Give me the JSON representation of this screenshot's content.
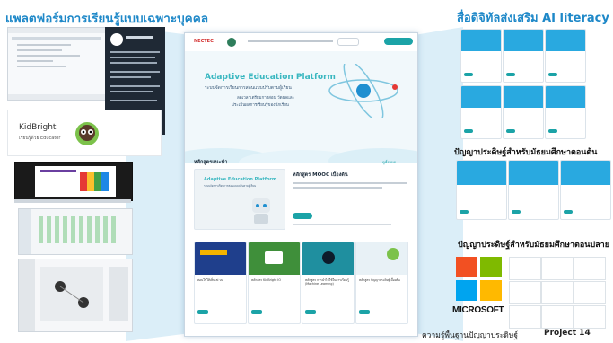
{
  "left_title": "แพลตฟอร์มการเรียนรู้แบบเฉพาะบุคคล",
  "right_title": "สื่อดิจิทัลส่งเสริม AI literacy",
  "kidbright": {
    "name": "KidBright",
    "sub": "เรียนรู้ด้วย Educator"
  },
  "site": {
    "brand": "NECTEC",
    "hero_title": "Adaptive Education Platform",
    "hero_subtitle": "ระบบจัดการเรียนการสอนแบบปรับตามผู้เรียน",
    "hero_line1": "ลดเวลาเตรียมการสอน วัดผลและ",
    "hero_line2": "ประเมินผลการเรียนรู้ของนักเรียน",
    "section_label": "หลักสูตรแนะนำ",
    "see_all": "ดูทั้งหมด",
    "featured_heading": "หลักสูตร MOOC เบื้องต้น",
    "featured_box_title": "Adaptive Education Platform",
    "featured_box_sub": "ระบบจัดการเรียนการสอนแบบปรับตามผู้เรียน",
    "featured_btn": "ดูรายละเอียด",
    "card_titles": [
      "สอนใช้ให้เห็น ai บน",
      "หลักสูตร KidBright IO",
      "หลักสูตร การนำไปใช้ในการเรียนรู้ (Machine Learning)",
      "หลักสูตร ปัญญาประดิษฐ์เบื้องต้น"
    ]
  },
  "section_elementary": "ปัญญาประดิษฐ์สำหรับมัธยมศึกษาตอนต้น",
  "section_secondary": "ปัญญาประดิษฐ์สำหรับมัธยมศึกษาตอนปลาย",
  "microsoft_text": "MICROSOFT",
  "bottom_caption": "ความรู้พื้นฐานปัญญาประดิษฐ์",
  "project_label": "Project 14",
  "colors": {
    "accent": "#1e88c8",
    "teal": "#1ba3a7"
  }
}
